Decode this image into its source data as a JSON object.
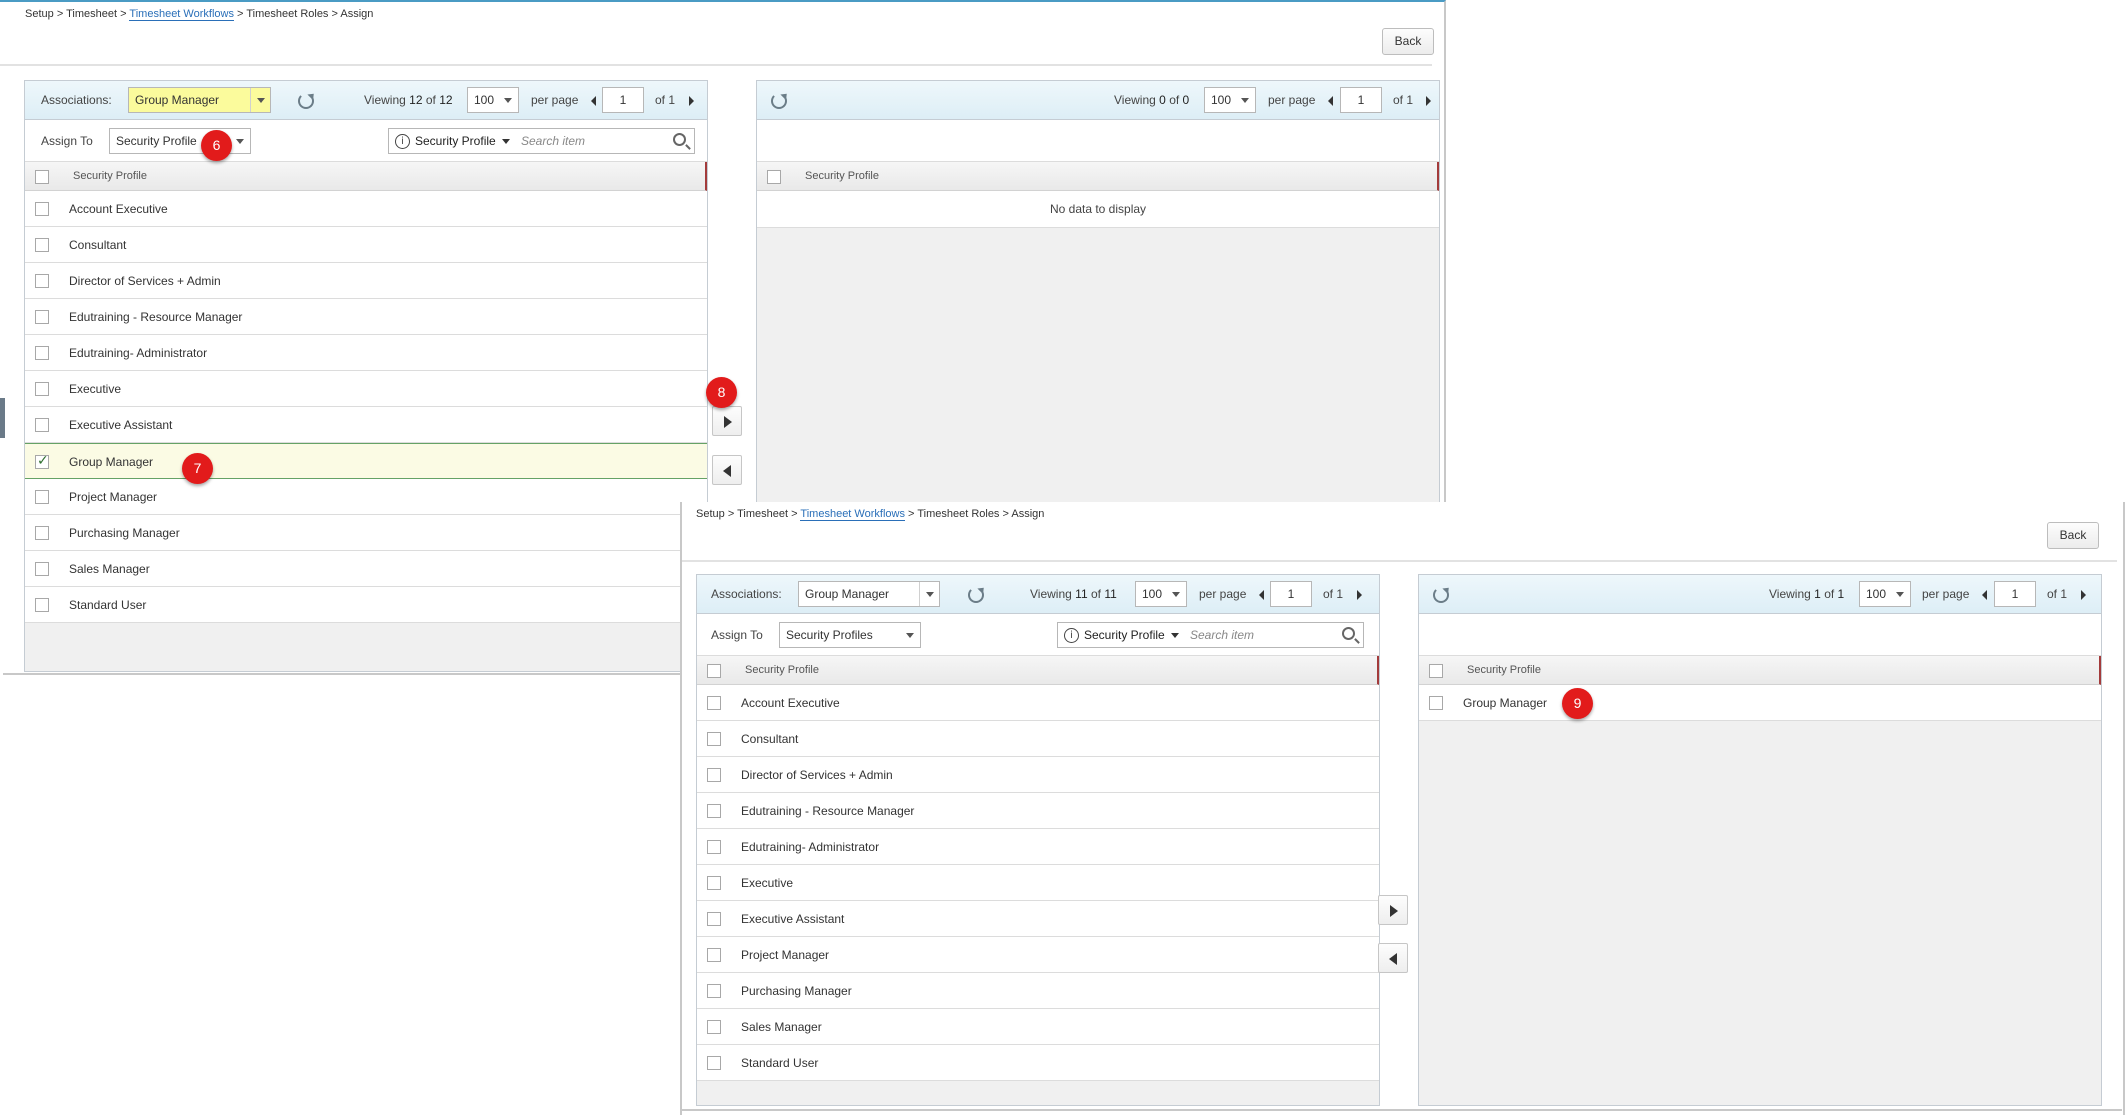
{
  "top": {
    "breadcrumb": {
      "setup": "Setup",
      "timesheet": "Timesheet",
      "workflows": "Timesheet Workflows",
      "roles": "Timesheet Roles",
      "assign": "Assign",
      "sep": ">"
    },
    "back_label": "Back",
    "associations_label": "Associations:",
    "associations_value": "Group Manager",
    "assign_to_label": "Assign To",
    "assign_to_value": "Security Profile",
    "left_pager": {
      "viewing": "Viewing",
      "count": "12",
      "of_word": "of",
      "total": "12",
      "per_page_value": "100",
      "per_page_label": "per page",
      "page": "1",
      "of_pages": "of 1"
    },
    "right_pager": {
      "viewing": "Viewing",
      "count": "0",
      "of_word": "of",
      "total": "0",
      "per_page_value": "100",
      "per_page_label": "per page",
      "page": "1",
      "of_pages": "of 1"
    },
    "search_field": "Security Profile",
    "search_placeholder": "Search item",
    "left_header": "Security Profile",
    "right_header": "Security Profile",
    "left_rows": [
      {
        "label": "Account Executive",
        "checked": false
      },
      {
        "label": "Consultant",
        "checked": false
      },
      {
        "label": "Director of Services + Admin",
        "checked": false
      },
      {
        "label": "Edutraining - Resource Manager",
        "checked": false
      },
      {
        "label": "Edutraining- Administrator",
        "checked": false
      },
      {
        "label": "Executive",
        "checked": false
      },
      {
        "label": "Executive Assistant",
        "checked": false
      },
      {
        "label": "Group Manager",
        "checked": true
      },
      {
        "label": "Project Manager",
        "checked": false
      },
      {
        "label": "Purchasing Manager",
        "checked": false
      },
      {
        "label": "Sales Manager",
        "checked": false
      },
      {
        "label": "Standard User",
        "checked": false
      }
    ],
    "no_data": "No data to display",
    "badges": {
      "assign_to": "6",
      "row": "7",
      "move": "8"
    }
  },
  "bottom": {
    "breadcrumb": {
      "setup": "Setup",
      "timesheet": "Timesheet",
      "workflows": "Timesheet Workflows",
      "roles": "Timesheet Roles",
      "assign": "Assign",
      "sep": ">"
    },
    "back_label": "Back",
    "associations_label": "Associations:",
    "associations_value": "Group Manager",
    "assign_to_label": "Assign To",
    "assign_to_value": "Security Profiles",
    "left_pager": {
      "viewing": "Viewing",
      "count": "11",
      "of_word": "of",
      "total": "11",
      "per_page_value": "100",
      "per_page_label": "per page",
      "page": "1",
      "of_pages": "of 1"
    },
    "right_pager": {
      "viewing": "Viewing",
      "count": "1",
      "of_word": "of",
      "total": "1",
      "per_page_value": "100",
      "per_page_label": "per page",
      "page": "1",
      "of_pages": "of 1"
    },
    "search_field": "Security Profile",
    "search_placeholder": "Search item",
    "left_header": "Security Profile",
    "right_header": "Security Profile",
    "left_rows": [
      {
        "label": "Account Executive"
      },
      {
        "label": "Consultant"
      },
      {
        "label": "Director of Services + Admin"
      },
      {
        "label": "Edutraining - Resource Manager"
      },
      {
        "label": "Edutraining- Administrator"
      },
      {
        "label": "Executive"
      },
      {
        "label": "Executive Assistant"
      },
      {
        "label": "Project Manager"
      },
      {
        "label": "Purchasing Manager"
      },
      {
        "label": "Sales Manager"
      },
      {
        "label": "Standard User"
      }
    ],
    "right_rows": [
      {
        "label": "Group Manager"
      }
    ],
    "badges": {
      "assigned": "9"
    }
  },
  "colors": {
    "highlight": "#fbfb9c",
    "badge": "#e21b1b",
    "link": "#2a6fb8",
    "selected_row": "#fbfbe4"
  }
}
